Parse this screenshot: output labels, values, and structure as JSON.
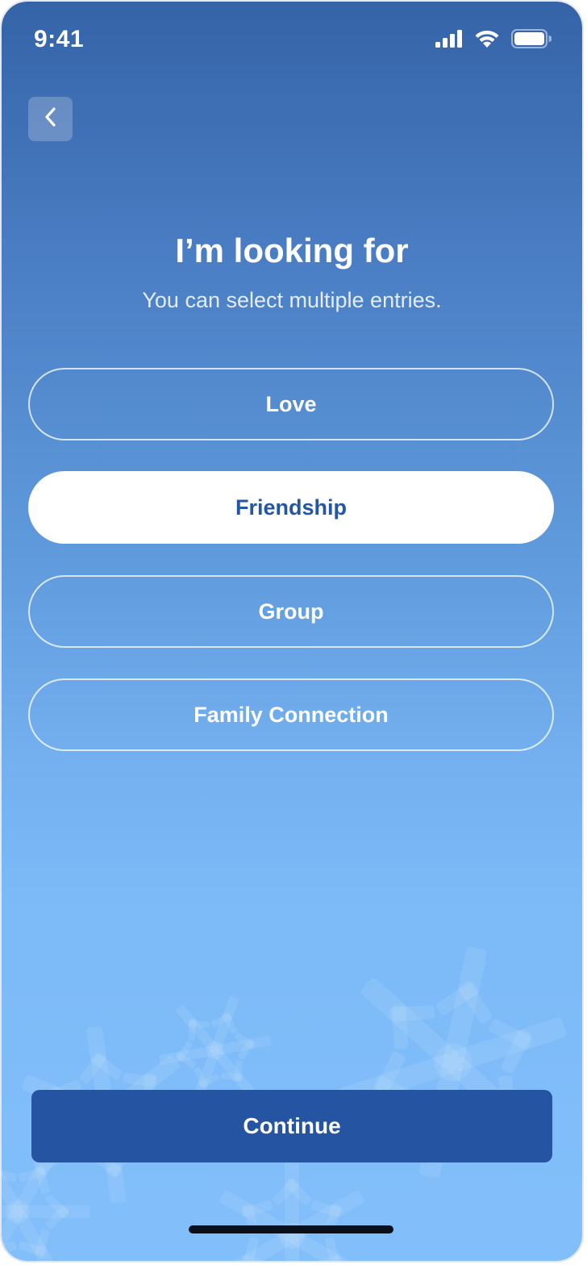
{
  "status_bar": {
    "time": "9:41",
    "icons": [
      "cellular-signal-icon",
      "wifi-icon",
      "battery-icon"
    ]
  },
  "header": {
    "back_icon": "chevron-left-icon"
  },
  "main": {
    "title": "I’m looking for",
    "subtitle": "You can select multiple entries.",
    "options": [
      {
        "label": "Love",
        "selected": false
      },
      {
        "label": "Friendship",
        "selected": true
      },
      {
        "label": "Group",
        "selected": false
      },
      {
        "label": "Family Connection",
        "selected": false
      }
    ]
  },
  "footer": {
    "continue_label": "Continue"
  },
  "colors": {
    "background_top": "#3563a8",
    "background_bottom": "#82bffa",
    "accent": "#2454a2",
    "selected_text": "#2456a4"
  }
}
